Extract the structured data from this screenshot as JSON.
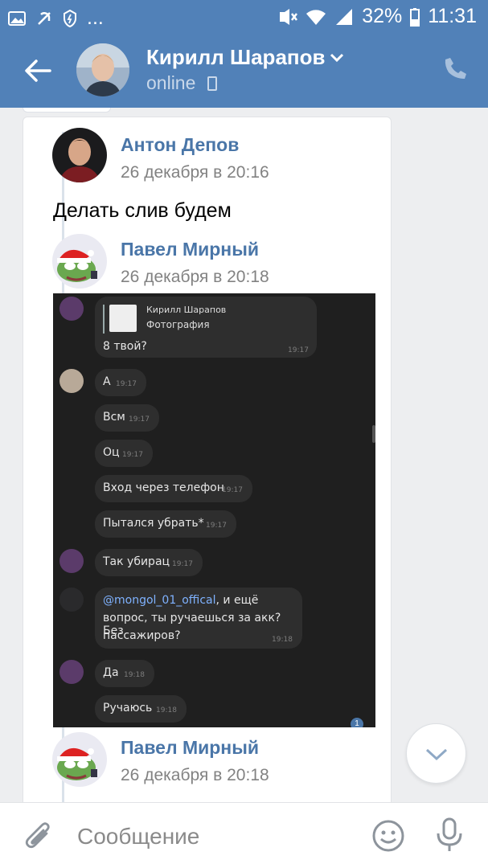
{
  "statusbar": {
    "battery": "32%",
    "time": "11:31",
    "more": "..."
  },
  "header": {
    "name": "Кирилл Шарапов",
    "status": "online"
  },
  "messages": [
    {
      "author": "Антон Депов",
      "date": "26 декабря в 20:16",
      "text": "Делать слив будем"
    },
    {
      "author": "Павел Мирный",
      "date": "26 декабря в 20:18"
    },
    {
      "author": "Павел Мирный",
      "date": "26 декабря в 20:18"
    }
  ],
  "screenshot": {
    "reply_author": "Кирилл Шарапов",
    "reply_attachment": "Фотография",
    "bubbles": [
      {
        "text": "8 твой?",
        "time": "19:17"
      },
      {
        "text": "А",
        "time": "19:17"
      },
      {
        "text": "Всм",
        "time": "19:17"
      },
      {
        "text": "Оц",
        "time": "19:17"
      },
      {
        "text": "Вход через телефон",
        "time": "19:17"
      },
      {
        "text": "Пытался убрать*",
        "time": "19:17"
      },
      {
        "text": "Так убирац",
        "time": "19:17"
      },
      {
        "mention": "@mongol_01_offical",
        "text": ", и ещё",
        "text2": "вопрос, ты ручаешься за акк? Без",
        "text3": "пассажиров?",
        "time": "19:18"
      },
      {
        "text": "Да",
        "time": "19:18"
      },
      {
        "text": "Ручаюсь",
        "time": "19:18"
      }
    ],
    "unread_badge": "1"
  },
  "composer": {
    "placeholder": "Сообщение"
  },
  "colors": {
    "brand": "#5181b8",
    "link": "#4a76a8",
    "date": "#828282"
  },
  "icons": [
    "back-arrow-icon",
    "chevron-down-icon",
    "phone-icon",
    "mobile-icon",
    "paperclip-icon",
    "emoji-icon",
    "microphone-icon",
    "chevron-down-icon"
  ]
}
